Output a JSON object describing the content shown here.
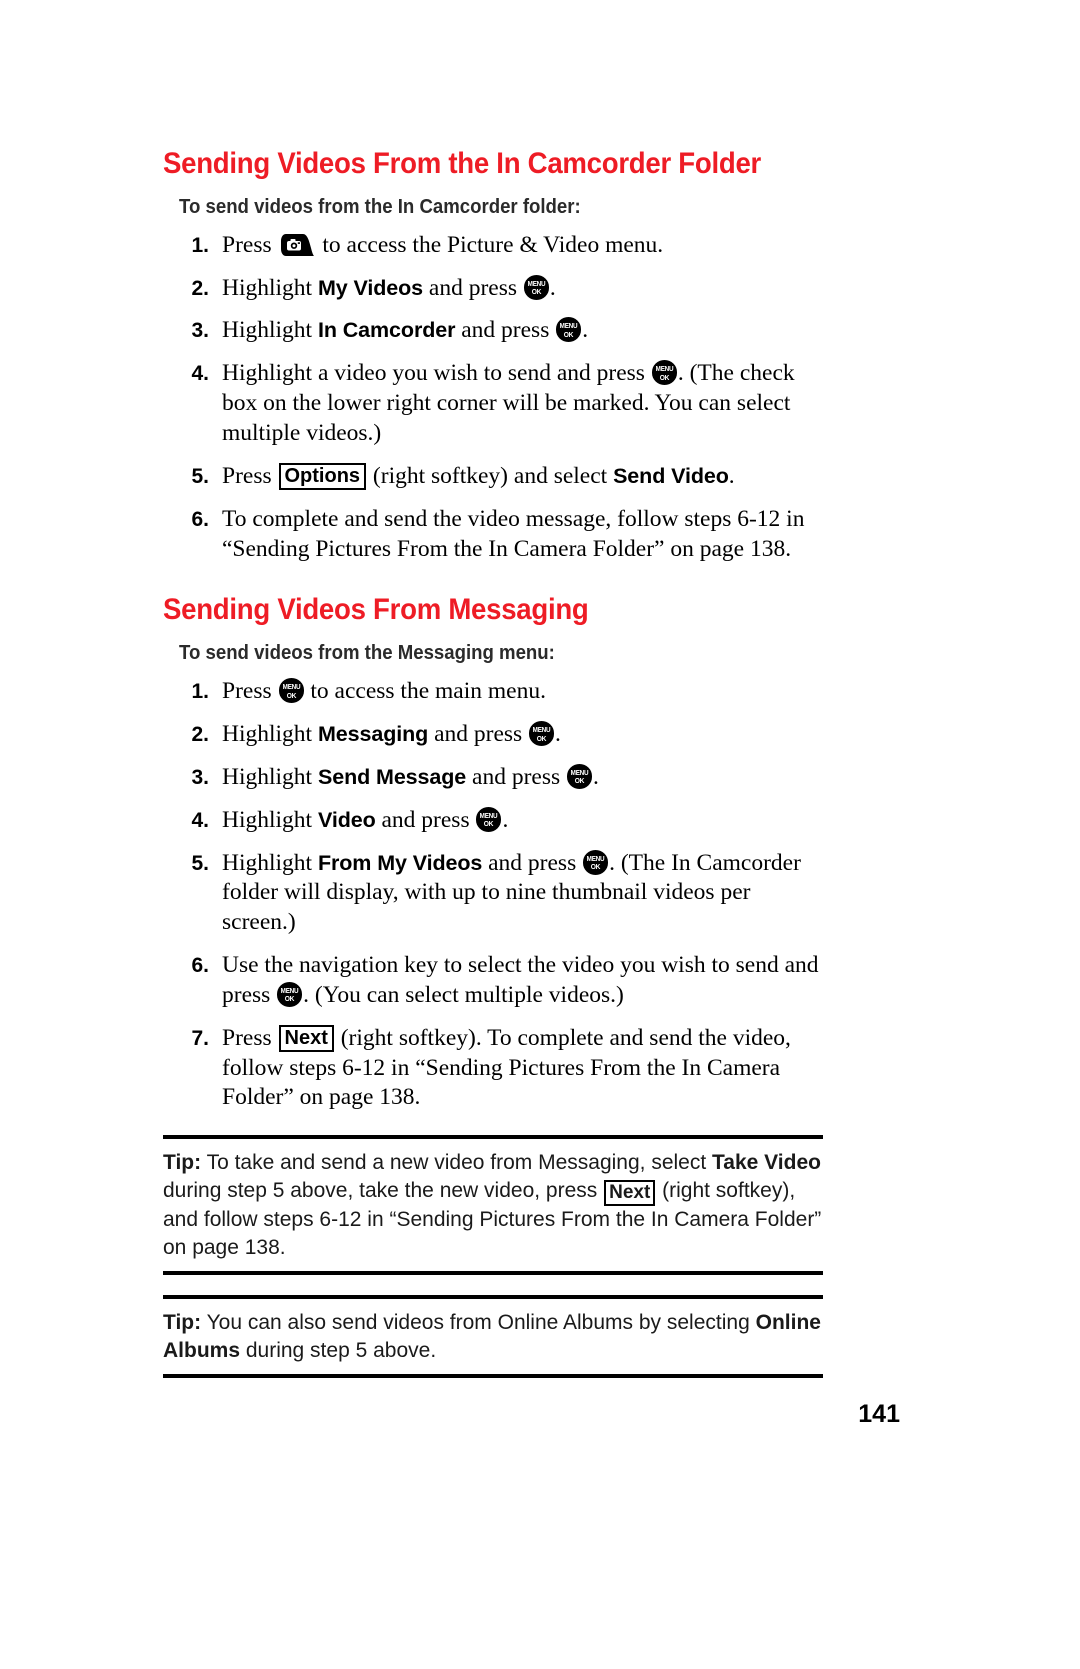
{
  "document": {
    "page_number": "141",
    "accent_color": "#ee1c25",
    "text_color": "#000000"
  },
  "sections": [
    {
      "heading": "Sending Videos From the In Camcorder Folder",
      "sub_heading": "To send videos from the In Camcorder folder:",
      "steps": [
        {
          "num": "1.",
          "parts": [
            {
              "t": "text",
              "v": "Press "
            },
            {
              "t": "camera_key",
              "v": "camera-key"
            },
            {
              "t": "text",
              "v": " to access the Picture & Video menu."
            }
          ]
        },
        {
          "num": "2.",
          "parts": [
            {
              "t": "text",
              "v": "Highlight "
            },
            {
              "t": "term",
              "v": "My Videos"
            },
            {
              "t": "text",
              "v": " and press "
            },
            {
              "t": "menu_key",
              "v": "MENU/OK"
            },
            {
              "t": "text",
              "v": "."
            }
          ]
        },
        {
          "num": "3.",
          "parts": [
            {
              "t": "text",
              "v": "Highlight "
            },
            {
              "t": "term",
              "v": "In Camcorder"
            },
            {
              "t": "text",
              "v": " and press "
            },
            {
              "t": "menu_key",
              "v": "MENU/OK"
            },
            {
              "t": "text",
              "v": "."
            }
          ]
        },
        {
          "num": "4.",
          "parts": [
            {
              "t": "text",
              "v": "Highlight a video you wish to send and press "
            },
            {
              "t": "menu_key",
              "v": "MENU/OK"
            },
            {
              "t": "text",
              "v": ". (The check box on the lower right corner will be marked. You can select multiple videos.)"
            }
          ]
        },
        {
          "num": "5.",
          "parts": [
            {
              "t": "text",
              "v": "Press "
            },
            {
              "t": "softkey",
              "v": "Options"
            },
            {
              "t": "text",
              "v": " (right softkey) and select "
            },
            {
              "t": "term",
              "v": "Send Video"
            },
            {
              "t": "text",
              "v": "."
            }
          ]
        },
        {
          "num": "6.",
          "parts": [
            {
              "t": "text",
              "v": "To complete and send the video message, follow steps 6-12 in “Sending Pictures From the In Camera Folder” on page 138."
            }
          ]
        }
      ]
    },
    {
      "heading": "Sending Videos From Messaging",
      "sub_heading": "To send videos from the Messaging menu:",
      "steps": [
        {
          "num": "1.",
          "parts": [
            {
              "t": "text",
              "v": "Press "
            },
            {
              "t": "menu_key",
              "v": "MENU/OK"
            },
            {
              "t": "text",
              "v": " to access the main menu."
            }
          ]
        },
        {
          "num": "2.",
          "parts": [
            {
              "t": "text",
              "v": "Highlight "
            },
            {
              "t": "term",
              "v": "Messaging"
            },
            {
              "t": "text",
              "v": " and press "
            },
            {
              "t": "menu_key",
              "v": "MENU/OK"
            },
            {
              "t": "text",
              "v": "."
            }
          ]
        },
        {
          "num": "3.",
          "parts": [
            {
              "t": "text",
              "v": "Highlight "
            },
            {
              "t": "term",
              "v": "Send Message"
            },
            {
              "t": "text",
              "v": " and press "
            },
            {
              "t": "menu_key",
              "v": "MENU/OK"
            },
            {
              "t": "text",
              "v": "."
            }
          ]
        },
        {
          "num": "4.",
          "parts": [
            {
              "t": "text",
              "v": "Highlight "
            },
            {
              "t": "term",
              "v": "Video"
            },
            {
              "t": "text",
              "v": " and press "
            },
            {
              "t": "menu_key",
              "v": "MENU/OK"
            },
            {
              "t": "text",
              "v": "."
            }
          ]
        },
        {
          "num": "5.",
          "parts": [
            {
              "t": "text",
              "v": "Highlight "
            },
            {
              "t": "term",
              "v": "From My Videos"
            },
            {
              "t": "text",
              "v": " and press "
            },
            {
              "t": "menu_key",
              "v": "MENU/OK"
            },
            {
              "t": "text",
              "v": ". (The In Camcorder folder will display, with up to nine thumbnail videos per screen.)"
            }
          ]
        },
        {
          "num": "6.",
          "parts": [
            {
              "t": "text",
              "v": "Use the navigation key to select the video you wish to send and press "
            },
            {
              "t": "menu_key",
              "v": "MENU/OK"
            },
            {
              "t": "text",
              "v": ". (You can select multiple videos.)"
            }
          ]
        },
        {
          "num": "7.",
          "parts": [
            {
              "t": "text",
              "v": "Press "
            },
            {
              "t": "softkey",
              "v": "Next"
            },
            {
              "t": "text",
              "v": " (right softkey). To complete and send the video, follow steps 6-12 in “Sending Pictures From the In Camera Folder” on page 138."
            }
          ]
        }
      ]
    }
  ],
  "tips": [
    {
      "label": "Tip:",
      "parts": [
        {
          "t": "text",
          "v": " To take and send a new video from Messaging, select "
        },
        {
          "t": "bold",
          "v": "Take Video"
        },
        {
          "t": "text",
          "v": " during step 5 above, take the new video, press "
        },
        {
          "t": "softkey",
          "v": "Next"
        },
        {
          "t": "text",
          "v": " (right softkey), and follow steps 6-12 in “Sending Pictures From the In Camera Folder” on page 138."
        }
      ]
    },
    {
      "label": "Tip:",
      "parts": [
        {
          "t": "text",
          "v": " You can also send videos from Online Albums by selecting "
        },
        {
          "t": "bold",
          "v": "Online Albums"
        },
        {
          "t": "text",
          "v": " during step 5 above."
        }
      ]
    }
  ]
}
